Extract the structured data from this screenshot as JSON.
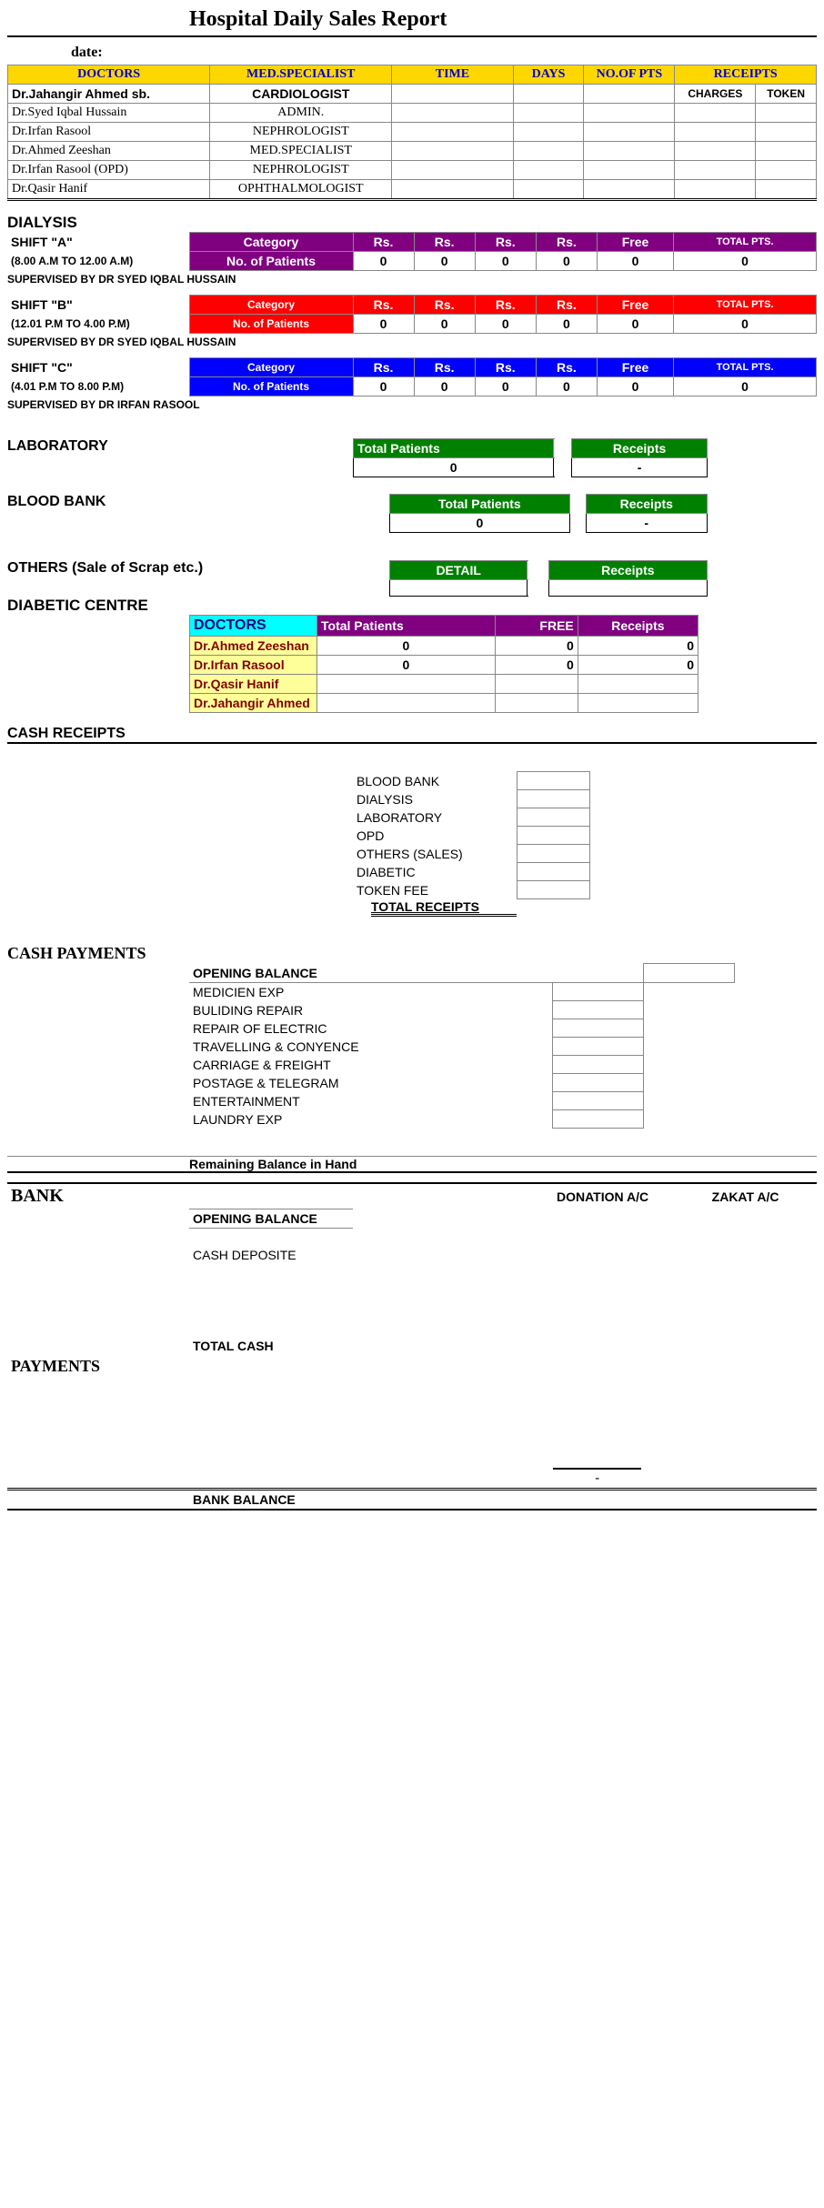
{
  "title": "Hospital Daily Sales Report",
  "date_label": "date:",
  "doc_headers": [
    "DOCTORS",
    "MED.SPECIALIST",
    "TIME",
    "DAYS",
    "NO.OF PTS",
    "RECEIPTS"
  ],
  "charges_row": [
    "CHARGES",
    "TOKEN"
  ],
  "doctors": [
    {
      "name": "Dr.Jahangir Ahmed sb.",
      "spec": "CARDIOLOGIST"
    },
    {
      "name": "Dr.Syed Iqbal Hussain",
      "spec": "ADMIN."
    },
    {
      "name": "Dr.Irfan Rasool",
      "spec": "NEPHROLOGIST"
    },
    {
      "name": "Dr.Ahmed Zeeshan",
      "spec": "MED.SPECIALIST"
    },
    {
      "name": "Dr.Irfan Rasool (OPD)",
      "spec": "NEPHROLOGIST"
    },
    {
      "name": "Dr.Qasir Hanif",
      "spec": "OPHTHALMOLOGIST"
    }
  ],
  "dialysis": {
    "title": "DIALYSIS",
    "shifts": [
      {
        "name": "SHIFT \"A\"",
        "time": "(8.00 A.M TO 12.00 A.M)",
        "sup": "SUPERVISED BY DR SYED IQBAL HUSSAIN",
        "color": "purple"
      },
      {
        "name": "SHIFT \"B\"",
        "time": "(12.01 P.M TO 4.00 P.M)",
        "sup": "SUPERVISED BY DR SYED IQBAL HUSSAIN",
        "color": "red"
      },
      {
        "name": "SHIFT \"C\"",
        "time": "(4.01 P.M TO 8.00 P.M)",
        "sup": "SUPERVISED BY DR IRFAN RASOOL",
        "color": "blue"
      }
    ],
    "cat_label": "Category",
    "num_label": "No. of Patients",
    "headers": [
      "Rs.",
      "Rs.",
      "Rs.",
      "Rs.",
      "Free",
      "TOTAL PTS."
    ],
    "values": [
      "0",
      "0",
      "0",
      "0",
      "0",
      "0"
    ]
  },
  "lab": {
    "title": "LABORATORY",
    "h1": "Total Patients",
    "h2": "Receipts",
    "v1": "0",
    "v2": "-"
  },
  "bloodbank": {
    "title": "BLOOD BANK",
    "h1": "Total Patients",
    "h2": "Receipts",
    "v1": "0",
    "v2": "-"
  },
  "others": {
    "title": "OTHERS (Sale of Scrap etc.)",
    "h1": "DETAIL",
    "h2": "Receipts"
  },
  "diabetic": {
    "title": "DIABETIC CENTRE",
    "headers": [
      "DOCTORS",
      "Total Patients",
      "FREE",
      "Receipts"
    ],
    "rows": [
      {
        "doc": "Dr.Ahmed Zeeshan",
        "tp": "0",
        "free": "0",
        "rec": "0"
      },
      {
        "doc": "Dr.Irfan Rasool",
        "tp": "0",
        "free": "0",
        "rec": "0"
      },
      {
        "doc": "Dr.Qasir Hanif",
        "tp": "",
        "free": "",
        "rec": ""
      },
      {
        "doc": "Dr.Jahangir Ahmed",
        "tp": "",
        "free": "",
        "rec": ""
      }
    ]
  },
  "cash_receipts": {
    "title": "CASH RECEIPTS",
    "items": [
      "BLOOD BANK",
      "DIALYSIS",
      "LABORATORY",
      "OPD",
      "OTHERS (SALES)",
      "DIABETIC",
      "TOKEN FEE"
    ],
    "total_label": "TOTAL RECEIPTS"
  },
  "cash_payments": {
    "title": "CASH PAYMENTS",
    "opening": "OPENING BALANCE",
    "items": [
      "MEDICIEN EXP",
      "BULIDING REPAIR",
      "REPAIR OF ELECTRIC",
      "TRAVELLING & CONYENCE",
      "CARRIAGE  & FREIGHT",
      "POSTAGE & TELEGRAM",
      "ENTERTAINMENT",
      "LAUNDRY EXP"
    ],
    "remaining": "Remaining Balance in Hand"
  },
  "bank": {
    "title": "BANK",
    "donation": "DONATION A/C",
    "zakat": "ZAKAT A/C",
    "opening": "OPENING BALANCE",
    "cash_dep": "CASH DEPOSITE",
    "total_cash": "TOTAL CASH",
    "payments": "PAYMENTS",
    "dash": "-",
    "balance": "BANK BALANCE"
  }
}
